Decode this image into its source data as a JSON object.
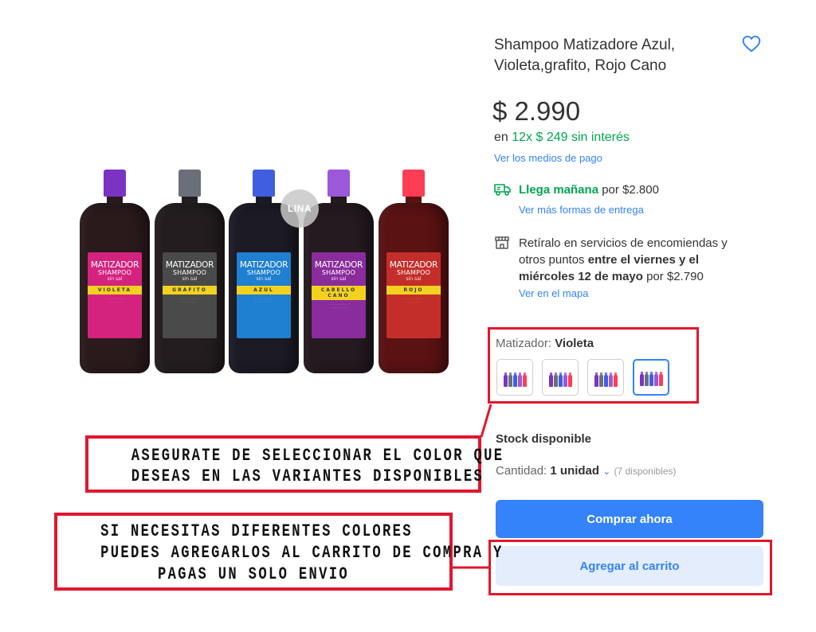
{
  "product": {
    "title": "Shampoo Matizadore Azul, Violeta,grafito, Rojo Cano",
    "price": "$ 2.990",
    "installments_prefix": "en",
    "installments": "12x $ 249 sin interés",
    "payment_link": "Ver los medios de pago"
  },
  "image": {
    "watermark": "LINA",
    "bottles": [
      {
        "title": "MATIZADOR",
        "subtitle": "SHAMPOO",
        "small": "sin sal",
        "band": "VIOLETA",
        "label_color": "#d4237f",
        "cap_color": "#7b33c4",
        "body_color": "#2a1a1c"
      },
      {
        "title": "MATIZADOR",
        "subtitle": "SHAMPOO",
        "small": "sin sal",
        "band": "GRAFITO",
        "label_color": "#4a4a4a",
        "cap_color": "#6a6f7a",
        "body_color": "#231d1f"
      },
      {
        "title": "MATIZADOR",
        "subtitle": "SHAMPOO",
        "small": "sin sal",
        "band": "AZUL",
        "label_color": "#1f7fd0",
        "cap_color": "#3f5ee0",
        "body_color": "#1c1a24"
      },
      {
        "title": "MATIZADOR",
        "subtitle": "SHAMPOO",
        "small": "sin sal",
        "band": "CABELLO CANO",
        "label_color": "#8a2c9c",
        "cap_color": "#9b58d8",
        "body_color": "#241a20"
      },
      {
        "title": "MATIZADOR",
        "subtitle": "SHAMPOO",
        "small": "sin sal",
        "band": "ROJO",
        "label_color": "#c42e2a",
        "cap_color": "#ff3d55",
        "body_color": "#5a1212"
      }
    ]
  },
  "shipping": {
    "highlight": "Llega mañana",
    "rest": "por $2.800",
    "link": "Ver más formas de entrega"
  },
  "pickup": {
    "line1": "Retíralo en servicios de encomiendas y",
    "line2a": "otros puntos",
    "line2b": "entre el viernes y el",
    "line3a": "miércoles 12 de mayo",
    "line3b": "por $2.790",
    "link": "Ver en el mapa"
  },
  "variant": {
    "label": "Matizador:",
    "selected": "Violeta",
    "swatch_count": 4
  },
  "stock": {
    "label": "Stock disponible",
    "quantity_label": "Cantidad:",
    "quantity_value": "1 unidad",
    "available": "(7 disponibles)"
  },
  "buttons": {
    "buy": "Comprar ahora",
    "cart": "Agregar al carrito"
  },
  "annotations": {
    "callout1": [
      "ASEGURATE DE SELECCIONAR EL COLOR QUE",
      "DESEAS EN LAS VARIANTES DISPONIBLES"
    ],
    "callout2": [
      "SI NECESITAS DIFERENTES COLORES",
      "PUEDES AGREGARLOS AL CARRITO DE COMPRA Y",
      "PAGAS UN SOLO ENVIO"
    ]
  },
  "colors": {
    "accent": "#3483fa",
    "green": "#00a650",
    "annotation_red": "#e3162d"
  },
  "icons": {
    "favorite": "heart-icon",
    "shipping": "truck-icon",
    "pickup": "store-icon",
    "quantity": "chevron-down-icon"
  }
}
